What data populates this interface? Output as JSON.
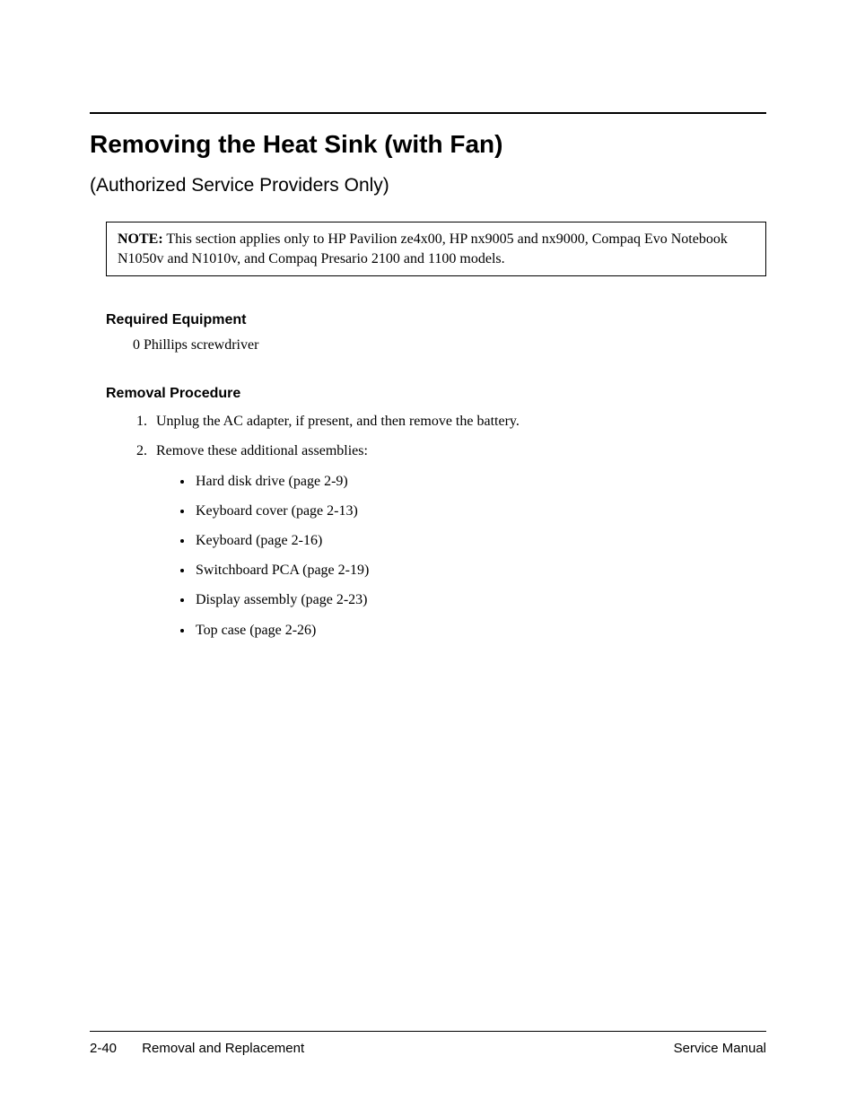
{
  "title": "Removing the Heat Sink (with Fan)",
  "subtitle": "(Authorized Service Providers Only)",
  "note": {
    "label": "NOTE:",
    "text": " This section applies only to HP Pavilion ze4x00, HP nx9005 and nx9000, Compaq Evo Notebook N1050v and N1010v, and Compaq Presario 2100 and 1100 models."
  },
  "required_equipment": {
    "heading": "Required Equipment",
    "item": "0 Phillips screwdriver"
  },
  "removal_procedure": {
    "heading": "Removal Procedure",
    "steps": [
      "Unplug the AC adapter, if present, and then remove the battery.",
      "Remove these additional assemblies:"
    ],
    "assemblies": [
      "Hard disk drive (page 2-9)",
      "Keyboard cover (page 2-13)",
      "Keyboard (page 2-16)",
      "Switchboard PCA (page 2-19)",
      "Display assembly (page 2-23)",
      "Top case (page 2-26)"
    ]
  },
  "footer": {
    "page_number": "2-40",
    "section": "Removal and Replacement",
    "doc_title": "Service Manual"
  }
}
